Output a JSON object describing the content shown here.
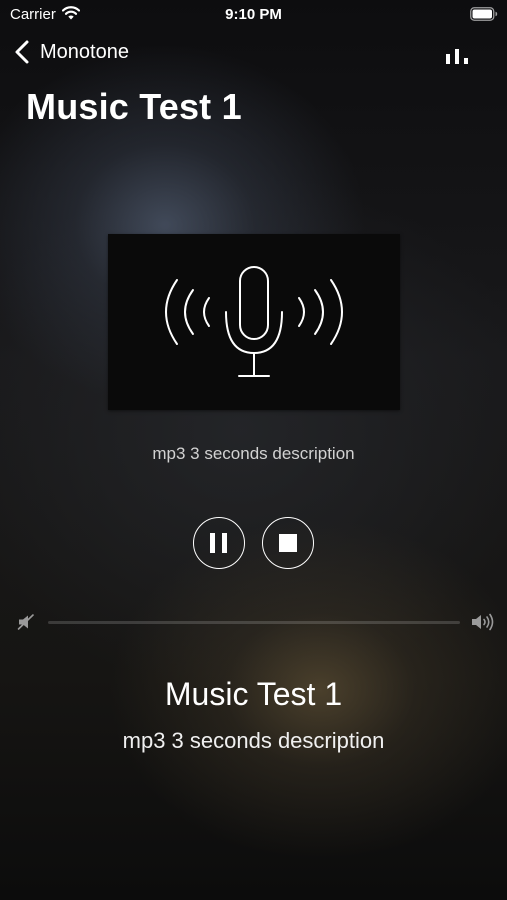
{
  "status_bar": {
    "carrier": "Carrier",
    "time": "9:10 PM"
  },
  "nav": {
    "back_label": "Monotone"
  },
  "page": {
    "title": "Music Test 1"
  },
  "artwork": {
    "icon": "microphone-broadcast-icon",
    "caption": "mp3 3 seconds description"
  },
  "controls": {
    "pause_icon": "pause-icon",
    "stop_icon": "stop-icon"
  },
  "volume": {
    "min_icon": "speaker-muted-icon",
    "max_icon": "speaker-loud-icon",
    "level": 0.0
  },
  "now_playing": {
    "title": "Music Test 1",
    "description": "mp3 3 seconds description"
  },
  "colors": {
    "text": "#ffffff",
    "caption": "#d2d2d2",
    "artwork_background": "#0a0a0a"
  }
}
